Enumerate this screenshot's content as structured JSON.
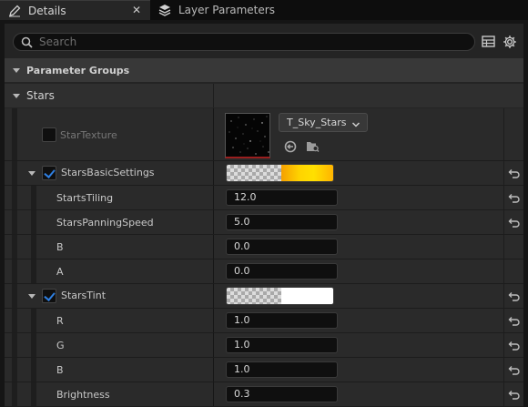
{
  "tabs": [
    {
      "label": "Details",
      "icon": "pencil-icon",
      "active": true,
      "close": "✕"
    },
    {
      "label": "Layer Parameters",
      "icon": "layers-icon",
      "active": false
    }
  ],
  "search": {
    "placeholder": "Search",
    "value": ""
  },
  "toolbar": {
    "icons": [
      "table-view-icon",
      "settings-gear-icon"
    ]
  },
  "categories": {
    "parameter_groups": "Parameter Groups",
    "stars": "Stars"
  },
  "texture": {
    "label": "StarTexture",
    "checked": false,
    "asset": "T_Sky_Stars",
    "buttons": [
      "use-selected-icon",
      "browse-asset-icon"
    ]
  },
  "properties": [
    {
      "label": "StarsBasicSettings",
      "kind": "group",
      "checked": true,
      "swatch_color": "#ffd400",
      "reset": true
    },
    {
      "label": "StartsTiling",
      "kind": "number",
      "value": "12.0",
      "reset": true
    },
    {
      "label": "StarsPanningSpeed",
      "kind": "number",
      "value": "5.0",
      "reset": true
    },
    {
      "label": "B",
      "kind": "number",
      "value": "0.0",
      "reset": false
    },
    {
      "label": "A",
      "kind": "number",
      "value": "0.0",
      "reset": false
    },
    {
      "label": "StarsTint",
      "kind": "group",
      "checked": true,
      "swatch_color": "#ffffff",
      "reset": true
    },
    {
      "label": "R",
      "kind": "number",
      "value": "1.0",
      "reset": true
    },
    {
      "label": "G",
      "kind": "number",
      "value": "1.0",
      "reset": true
    },
    {
      "label": "B",
      "kind": "number",
      "value": "1.0",
      "reset": true
    },
    {
      "label": "Brightness",
      "kind": "number",
      "value": "0.3",
      "reset": true
    }
  ],
  "colors": {
    "accent_check": "#2f7fe0",
    "panel": "#242424",
    "tab_bar": "#0d0d0d"
  }
}
